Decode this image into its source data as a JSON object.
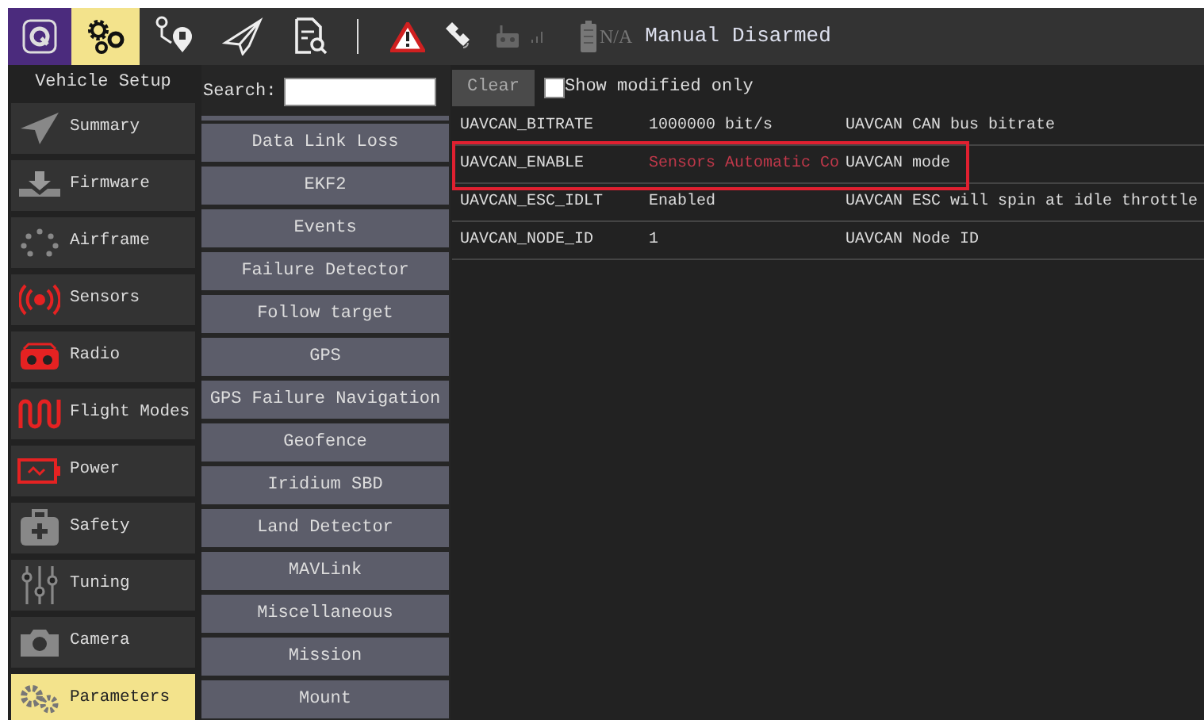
{
  "toolbar": {
    "views": [
      {
        "kind": "logo",
        "selected": false
      },
      {
        "kind": "setup",
        "selected": true
      },
      {
        "kind": "plan",
        "selected": false
      },
      {
        "kind": "fly",
        "selected": false
      },
      {
        "kind": "analyze",
        "selected": false
      }
    ],
    "status": {
      "battery": "N/A",
      "flight_mode": "Manual",
      "arm_state": "Disarmed"
    }
  },
  "sidebar": {
    "title": "Vehicle Setup",
    "items": [
      {
        "label": "Summary",
        "kind": "summary",
        "selected": false
      },
      {
        "label": "Firmware",
        "kind": "firmware",
        "selected": false
      },
      {
        "label": "Airframe",
        "kind": "airframe",
        "selected": false
      },
      {
        "label": "Sensors",
        "kind": "sensors",
        "selected": false
      },
      {
        "label": "Radio",
        "kind": "radio",
        "selected": false
      },
      {
        "label": "Flight Modes",
        "kind": "modes",
        "selected": false
      },
      {
        "label": "Power",
        "kind": "power",
        "selected": false
      },
      {
        "label": "Safety",
        "kind": "safety",
        "selected": false
      },
      {
        "label": "Tuning",
        "kind": "tuning",
        "selected": false
      },
      {
        "label": "Camera",
        "kind": "camera",
        "selected": false
      },
      {
        "label": "Parameters",
        "kind": "params",
        "selected": true
      }
    ]
  },
  "search": {
    "label": "Search:"
  },
  "groups": [
    "Data Link Loss",
    "EKF2",
    "Events",
    "Failure Detector",
    "Follow target",
    "GPS",
    "GPS Failure Navigation",
    "Geofence",
    "Iridium SBD",
    "Land Detector",
    "MAVLink",
    "Miscellaneous",
    "Mission",
    "Mount"
  ],
  "clear_button": "Clear",
  "show_modified": {
    "label": "Show modified only",
    "checked": false
  },
  "parameters": [
    {
      "name": "UAVCAN_BITRATE",
      "value": "1000000 bit/s",
      "description": "UAVCAN CAN bus bitrate",
      "modified": false,
      "highlighted": false
    },
    {
      "name": "UAVCAN_ENABLE",
      "value": "Sensors Automatic Co",
      "description": "UAVCAN mode",
      "modified": true,
      "highlighted": true
    },
    {
      "name": "UAVCAN_ESC_IDLT",
      "value": "Enabled",
      "description": "UAVCAN ESC will spin at idle throttle",
      "modified": false,
      "highlighted": false
    },
    {
      "name": "UAVCAN_NODE_ID",
      "value": "1",
      "description": "UAVCAN Node ID",
      "modified": false,
      "highlighted": false
    }
  ]
}
